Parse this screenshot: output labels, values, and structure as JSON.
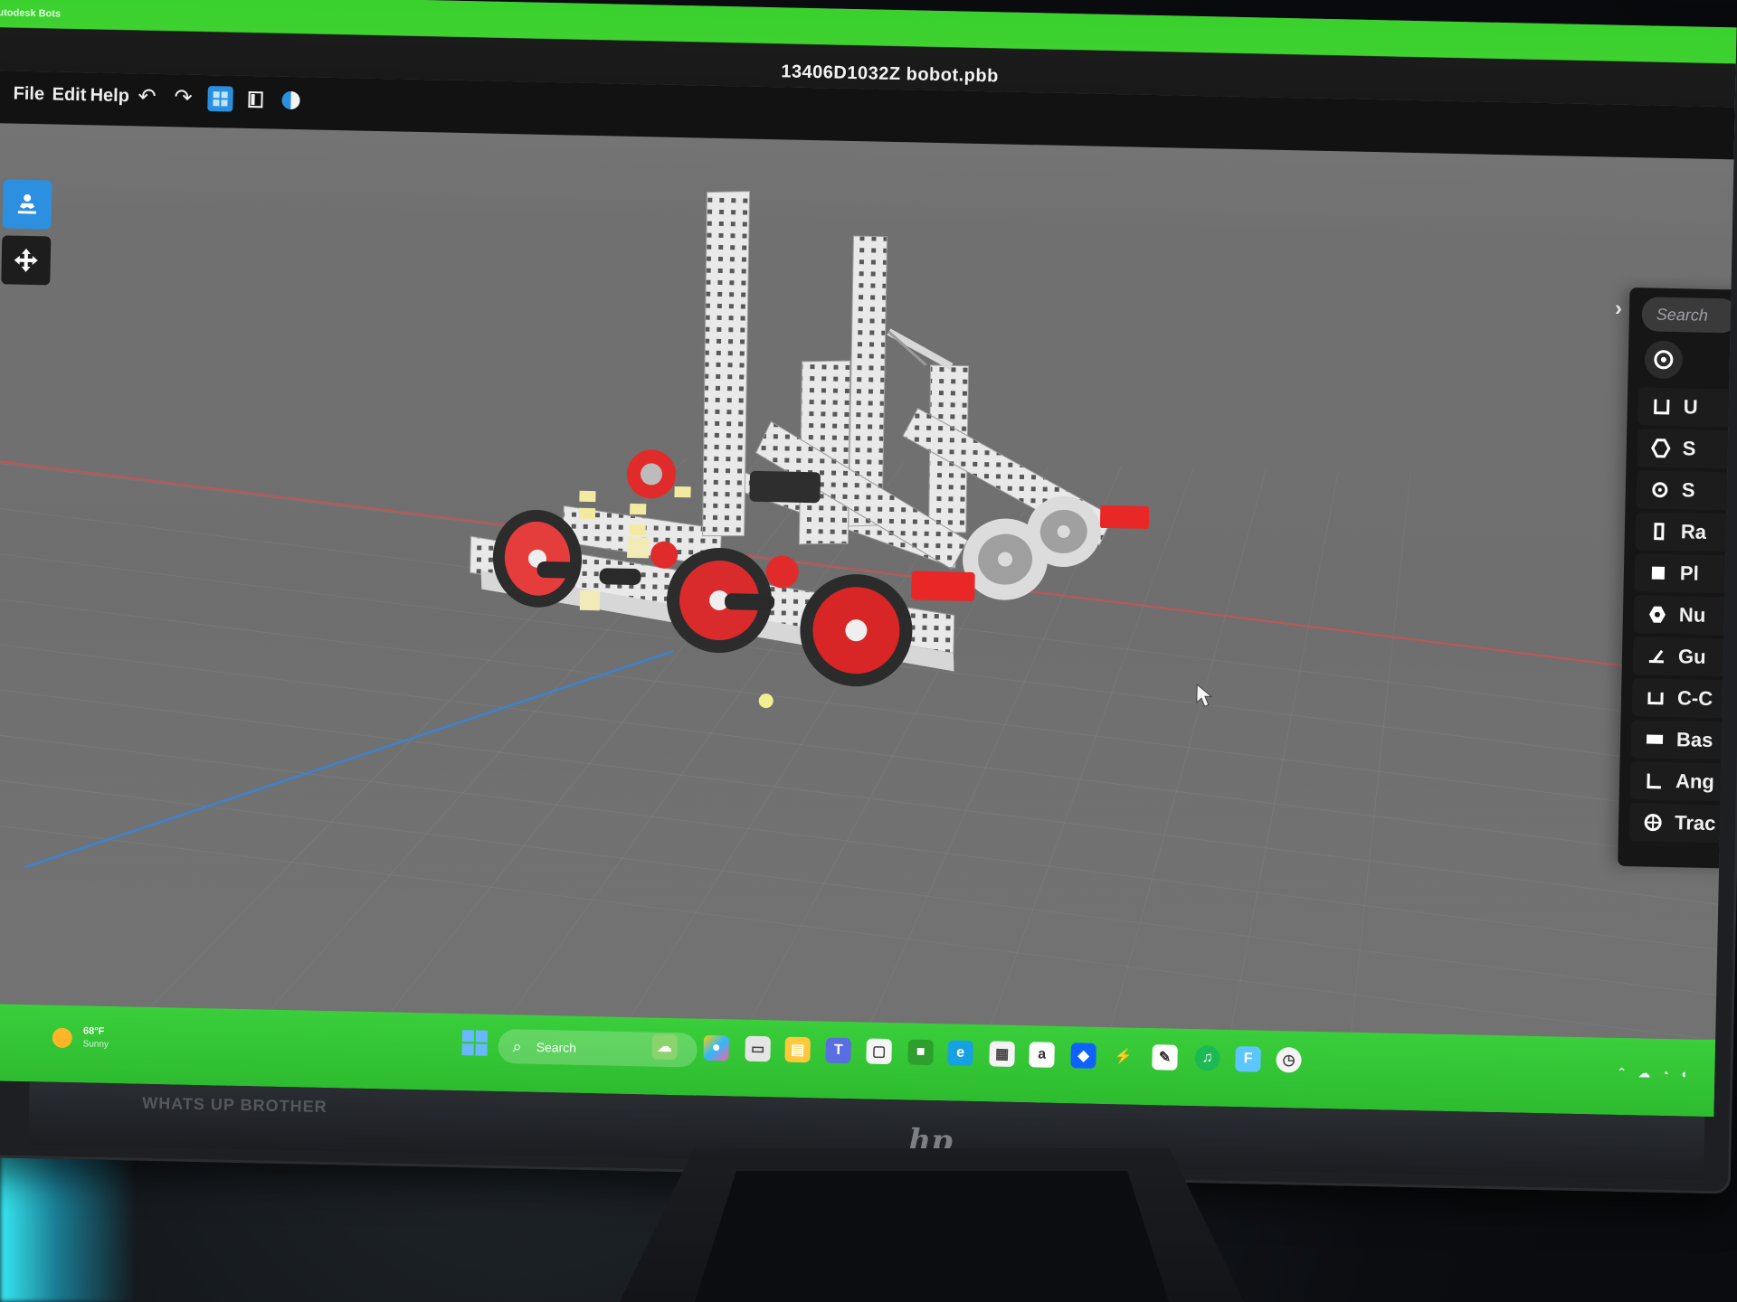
{
  "window": {
    "title": "13406D1032Z bobot.pbb",
    "app_badge": "Autodesk Bots"
  },
  "menu": {
    "file": "File",
    "edit": "Edit",
    "help": "Help"
  },
  "toolbar": {
    "icons": [
      "undo-icon",
      "redo-icon",
      "grid-icon",
      "panel-icon",
      "contrast-icon"
    ]
  },
  "sidebar": {
    "buttons": [
      "person-icon",
      "move-icon"
    ]
  },
  "parts_panel": {
    "search_placeholder": "Search",
    "items": [
      {
        "label": "U",
        "icon": "u-channel-icon"
      },
      {
        "label": "S",
        "icon": "hex-icon"
      },
      {
        "label": "S",
        "icon": "gear-icon"
      },
      {
        "label": "Ra",
        "icon": "rail-icon"
      },
      {
        "label": "Pl",
        "icon": "plate-icon"
      },
      {
        "label": "Nu",
        "icon": "nut-icon"
      },
      {
        "label": "Gu",
        "icon": "gusset-icon"
      },
      {
        "label": "C-C",
        "icon": "c-channel-icon"
      },
      {
        "label": "Bas",
        "icon": "base-icon"
      },
      {
        "label": "Ang",
        "icon": "angle-icon"
      },
      {
        "label": "Trac",
        "icon": "traction-wheel-icon"
      }
    ]
  },
  "taskbar": {
    "weather_temp": "68°F",
    "weather_desc": "Sunny",
    "search_label": "Search",
    "apps": [
      "widgets-icon",
      "copilot-icon",
      "files-icon",
      "folder-icon",
      "teams-icon",
      "note-icon",
      "minecraft-icon",
      "edge-icon",
      "calendar-icon",
      "amazon-icon",
      "dropbox-icon",
      "zap-icon",
      "chat-icon",
      "spotify-icon",
      "store-icon",
      "clock-icon"
    ]
  },
  "bezel": {
    "sticker_text": "WHATS UP BROTHER",
    "brand": "hp"
  },
  "colors": {
    "accent": "#39d12d",
    "viewport": "#767676",
    "active_blue": "#2b8fe0"
  }
}
